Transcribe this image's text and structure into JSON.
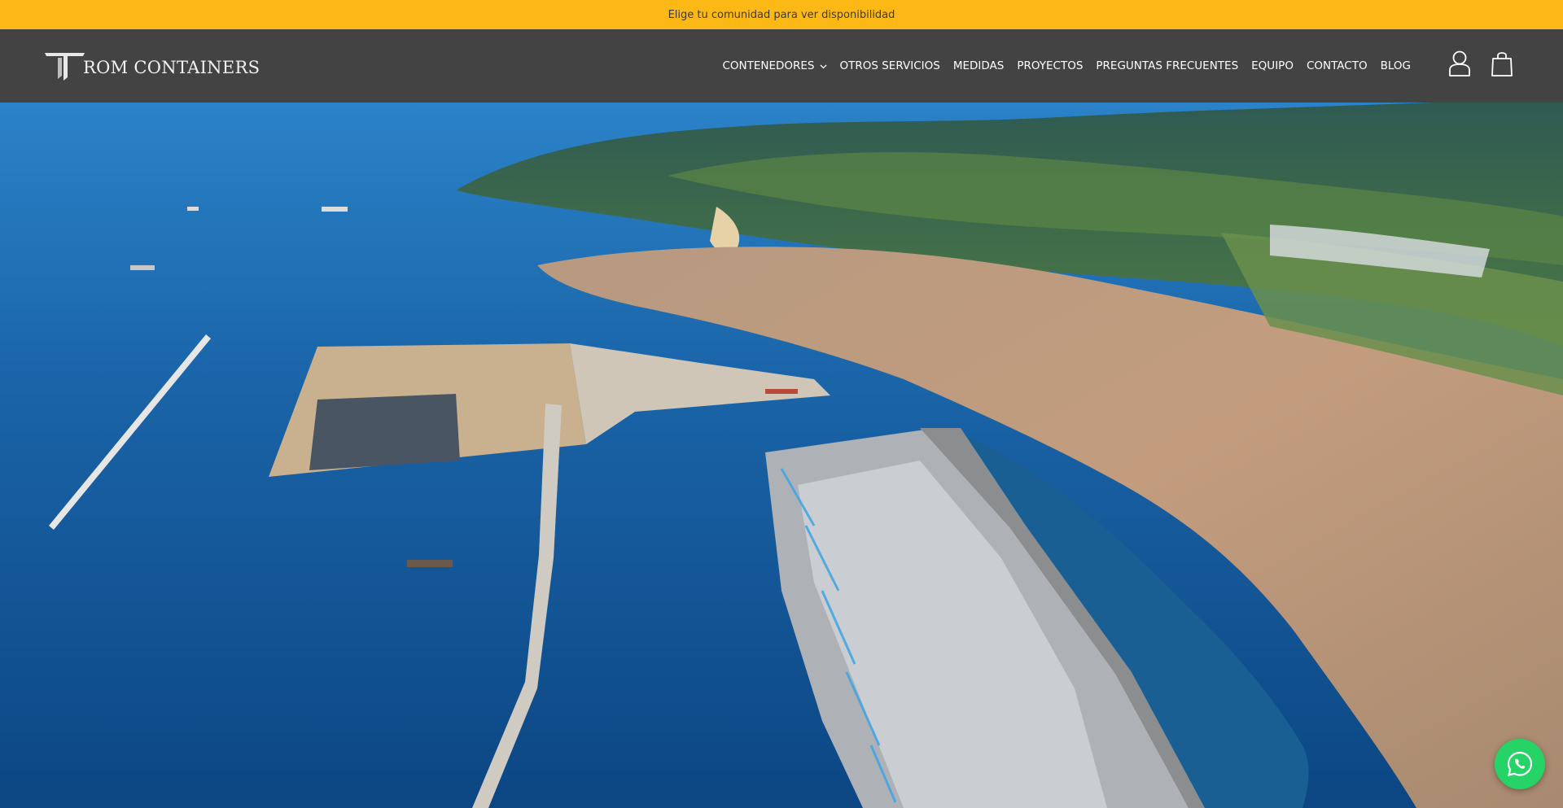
{
  "announcement": {
    "text": "Elige tu comunidad para ver disponibilidad"
  },
  "brand": {
    "logo_text": "ROM CONTAINERS"
  },
  "nav": {
    "items": [
      {
        "label": "CONTENEDORES"
      },
      {
        "label": "OTROS SERVICIOS"
      },
      {
        "label": "MEDIDAS"
      },
      {
        "label": "PROYECTOS"
      },
      {
        "label": "PREGUNTAS FRECUENTES"
      },
      {
        "label": "EQUIPO"
      },
      {
        "label": "CONTACTO"
      },
      {
        "label": "BLOG"
      }
    ]
  },
  "icons": {
    "account": "user-icon",
    "cart": "shopping-bag-icon",
    "chat": "whatsapp-icon",
    "dropdown": "chevron-down-icon"
  },
  "colors": {
    "announcement_bg": "#fcb814",
    "header_bg": "#434343",
    "whatsapp": "#25d366"
  },
  "hero": {
    "image": "aerial-port-photo"
  }
}
